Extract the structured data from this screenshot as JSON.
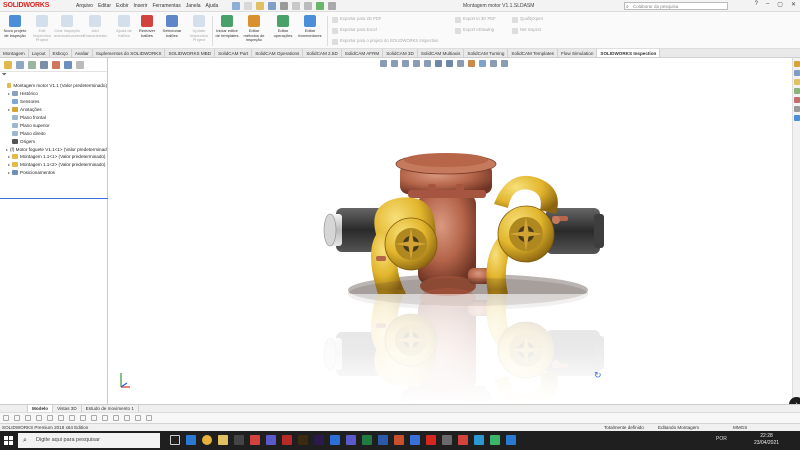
{
  "app": {
    "logo_text": "SOLIDWORKS",
    "document_title": "Montagem motor V1.1.SLDASM",
    "search_placeholder": "Colaborar da pesquisa"
  },
  "menu": [
    "Arquivo",
    "Editar",
    "Exibir",
    "Inserir",
    "Ferramentas",
    "Janela",
    "Ajuda"
  ],
  "ribbon": {
    "buttons": [
      {
        "label": "Novo projeto de inspeção",
        "color": "#4a8fd8",
        "disabled": false
      },
      {
        "label": "Edit Inspection Project",
        "color": "#9ab7d8",
        "disabled": true
      },
      {
        "label": "Criar inspeção automaticamente",
        "color": "#9ab7d8",
        "disabled": true
      },
      {
        "label": "Add Characteristic",
        "color": "#9ab7d8",
        "disabled": true
      },
      {
        "label": "Ajuda de balões",
        "color": "#9ab7d8",
        "disabled": true
      },
      {
        "label": "Remover balões",
        "color": "#d0443d",
        "disabled": false
      },
      {
        "label": "Selecionar balões",
        "color": "#5e86c9",
        "disabled": false
      },
      {
        "label": "Update Inspection Project",
        "color": "#9ab7d8",
        "disabled": true
      },
      {
        "label": "Iniciar editor de templates",
        "color": "#4aa06b",
        "disabled": false
      },
      {
        "label": "Editar métodos de inspeção",
        "color": "#d9912f",
        "disabled": false
      },
      {
        "label": "Editar operações",
        "color": "#4aa06b",
        "disabled": false
      },
      {
        "label": "Editar fornecedores",
        "color": "#4a8fd8",
        "disabled": false
      }
    ],
    "export_list_1": [
      "Exportar para 2D PDF",
      "Exportar para Excel",
      "Exportar para o projeto do SOLIDWORKS Inspection"
    ],
    "export_list_2": [
      "Export to 3D PDF",
      "Export eDrawing",
      "Export to SOLIDWORKS Inspection project"
    ],
    "export_list_3": [
      "QualityXpert",
      "Net Inspect"
    ]
  },
  "tabs": [
    "Montagem",
    "Layout",
    "Esboço",
    "Avaliar",
    "Suplementos do SOLIDWORKS",
    "SOLIDWORKS MBD",
    "SolidCAM Part",
    "SolidCAM Operations",
    "SolidCAM 2.5D",
    "SolidCAM AFRM",
    "SolidCAM 3D",
    "SolidCAM Multiaxis",
    "SolidCAM Turning",
    "SolidCAM Templates",
    "Flow Simulation",
    "SOLIDWORKS Inspection"
  ],
  "active_tab": "SOLIDWORKS Inspection",
  "tree": [
    {
      "label": "Montagem motor V1.1 (Valor predeterminado)",
      "indent": 0,
      "arrow": "",
      "icon": "#e5b94a"
    },
    {
      "label": "Histórico",
      "indent": 1,
      "arrow": "▸",
      "icon": "#8aa0bd"
    },
    {
      "label": "Sensores",
      "indent": 1,
      "arrow": "",
      "icon": "#7fa6d6"
    },
    {
      "label": "Anotações",
      "indent": 1,
      "arrow": "▸",
      "icon": "#d6a53a"
    },
    {
      "label": "Plano frontal",
      "indent": 1,
      "arrow": "",
      "icon": "#9fb6cf"
    },
    {
      "label": "Plano superior",
      "indent": 1,
      "arrow": "",
      "icon": "#9fb6cf"
    },
    {
      "label": "Plano direito",
      "indent": 1,
      "arrow": "",
      "icon": "#9fb6cf"
    },
    {
      "label": "Origem",
      "indent": 1,
      "arrow": "",
      "icon": "#555555"
    },
    {
      "label": "(f) Motor foguete V1.1<1> (Valor predeterminado)",
      "indent": 1,
      "arrow": "▸",
      "icon": "#c9a440"
    },
    {
      "label": "Montagem 1.1<1> (Valor predeterminado)",
      "indent": 1,
      "arrow": "▸",
      "icon": "#e5b94a"
    },
    {
      "label": "Montagem 1.1<2> (Valor predeterminado)",
      "indent": 1,
      "arrow": "▸",
      "icon": "#e5b94a"
    },
    {
      "label": "Posicionamentos",
      "indent": 1,
      "arrow": "▸",
      "icon": "#6d8fb8"
    }
  ],
  "bottom_tabs": [
    "",
    "Modelo",
    "Vistas 3D",
    "Estudo de movimento 1"
  ],
  "active_bottom_tab": "Modelo",
  "status": {
    "left": "SOLIDWORKS Premium 2018 x64 Edition",
    "defined": "Totalmente definido",
    "mode": "Editando Montagem",
    "units": "MMGS"
  },
  "taskbar": {
    "search_placeholder": "Digite aqui para pesquisar",
    "language": "POR",
    "time": "22:28",
    "date": "23/04/2021"
  },
  "colors": {
    "copper": "#b5654a",
    "brass": "#e2b52c",
    "motor": "#3a3a3a",
    "accent": "#3a6fd8"
  }
}
